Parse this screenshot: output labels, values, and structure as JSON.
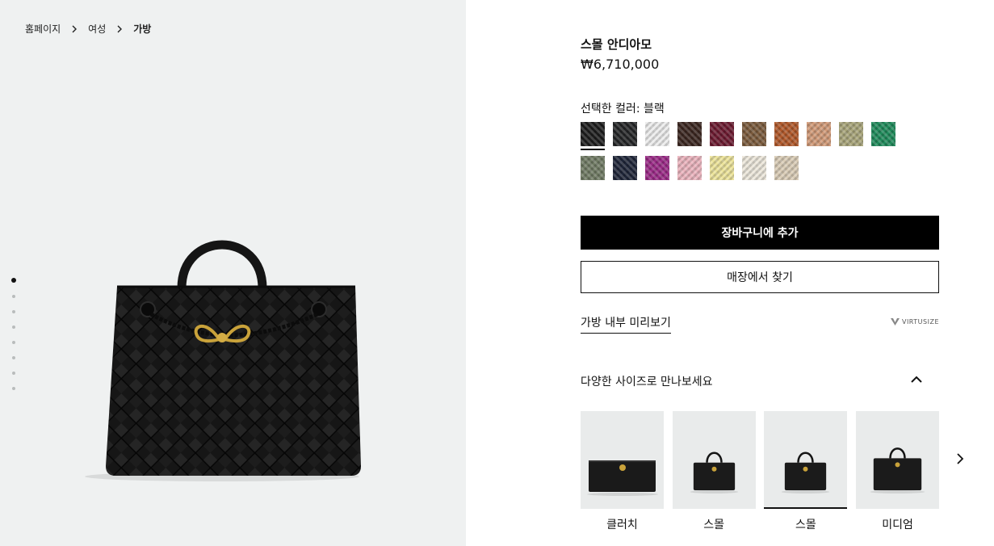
{
  "breadcrumb": {
    "items": [
      "홈페이지",
      "여성",
      "가방"
    ]
  },
  "gallery": {
    "dot_count": 8,
    "active_index": 0,
    "image_icon": "black-woven-handbag"
  },
  "product": {
    "name": "스몰 안디아모",
    "price": "₩6,710,000",
    "color_label": "선택한 컬러: 블랙"
  },
  "colors": [
    {
      "hex": "#1c1c1c",
      "selected": true
    },
    {
      "hex": "#232426"
    },
    {
      "hex": "#ececec"
    },
    {
      "hex": "#3a2620"
    },
    {
      "hex": "#6b1a30"
    },
    {
      "hex": "#7a5a3c"
    },
    {
      "hex": "#b0582a"
    },
    {
      "hex": "#d19a78"
    },
    {
      "hex": "#a8a57a"
    },
    {
      "hex": "#1f8a5a"
    },
    {
      "hex": "#6f7a63"
    },
    {
      "hex": "#1e2538"
    },
    {
      "hex": "#9a2a86"
    },
    {
      "hex": "#eab3bd"
    },
    {
      "hex": "#ece39a"
    },
    {
      "hex": "#ece6da"
    },
    {
      "hex": "#d9ccb6"
    }
  ],
  "actions": {
    "add_to_cart": "장바구니에 추가",
    "find_in_store": "매장에서 찾기",
    "preview_inside": "가방 내부 미리보기",
    "virtusize": "VIRTUSIZE"
  },
  "sizes": {
    "heading": "다양한 사이즈로 만나보세요",
    "items": [
      {
        "label": "클러치",
        "thumb": "clutch-bag-thumbnail"
      },
      {
        "label": "스몰",
        "thumb": "small-bag-thumbnail-1"
      },
      {
        "label": "스몰",
        "thumb": "small-bag-thumbnail-2",
        "selected": true
      },
      {
        "label": "미디엄",
        "thumb": "medium-bag-thumbnail"
      }
    ]
  }
}
